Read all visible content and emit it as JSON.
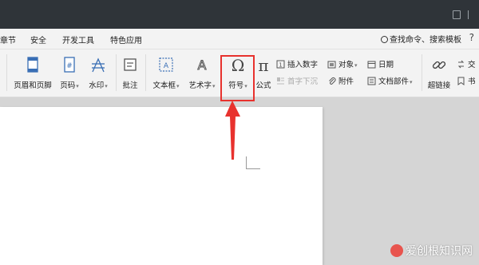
{
  "menubar": {
    "items": [
      "章节",
      "安全",
      "开发工具",
      "特色应用"
    ],
    "search": "查找命令、搜索模板",
    "help": "?"
  },
  "ribbon": {
    "header_footer": "页眉和页脚",
    "page_number": "页码",
    "watermark": "水印",
    "comment": "批注",
    "textbox": "文本框",
    "wordart": "艺术字",
    "symbol": "符号",
    "formula": "公式",
    "insert_number": "插入数字",
    "first_char_drop": "首字下沉",
    "object": "对象",
    "attachment": "附件",
    "date": "日期",
    "doc_parts": "文档部件",
    "hyperlink": "超链接",
    "cross_ref": "交",
    "bookmark": "书"
  },
  "highlight_color": "#e8322e",
  "watermark_text": "爱创根知识网",
  "icons": {
    "symbol": "omega-icon",
    "formula": "pi-icon"
  }
}
